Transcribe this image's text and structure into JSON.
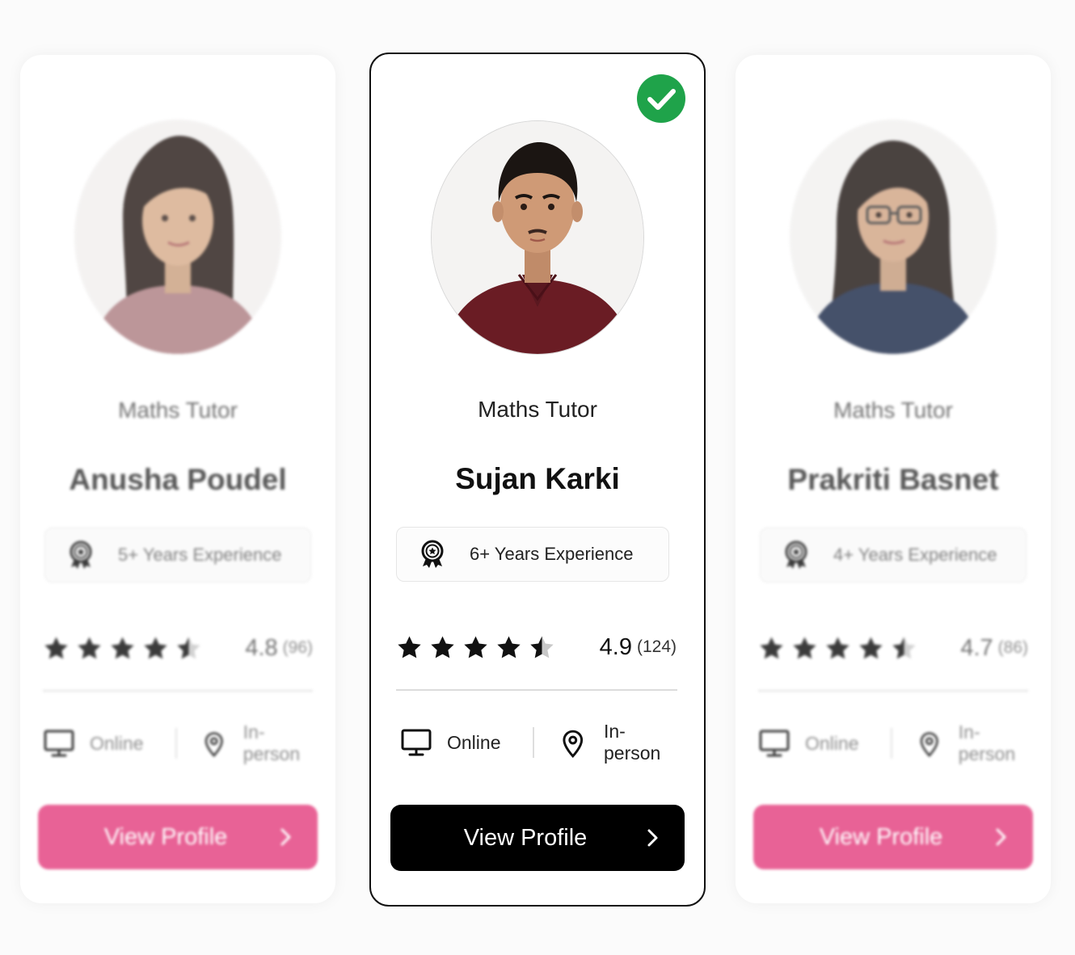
{
  "cards": [
    {
      "role": "Maths Tutor",
      "name": "Anusha Poudel",
      "experience": "5+ Years Experience",
      "rating": "4.8",
      "reviews": "(96)",
      "stars": 4.5,
      "mode_online": "Online",
      "mode_inperson": "In-person",
      "button": "View Profile",
      "selected": false
    },
    {
      "role": "Maths Tutor",
      "name": "Sujan Karki",
      "experience": "6+ Years Experience",
      "rating": "4.9",
      "reviews": "(124)",
      "stars": 4.5,
      "mode_online": "Online",
      "mode_inperson": "In-person",
      "button": "View Profile",
      "selected": true
    },
    {
      "role": "Maths Tutor",
      "name": "Prakriti Basnet",
      "experience": "4+ Years Experience",
      "rating": "4.7",
      "reviews": "(86)",
      "stars": 4.5,
      "mode_online": "Online",
      "mode_inperson": "In-person",
      "button": "View Profile",
      "selected": false
    }
  ],
  "colors": {
    "selected_check": "#1fa34a",
    "side_button": "#e4407f",
    "selected_button": "#000000",
    "selected_border": "#111111"
  },
  "icons": {
    "experience": "award-badge-icon",
    "online": "monitor-icon",
    "inperson": "location-pin-icon",
    "button": "chevron-right-icon",
    "selected": "check-circle-icon"
  }
}
